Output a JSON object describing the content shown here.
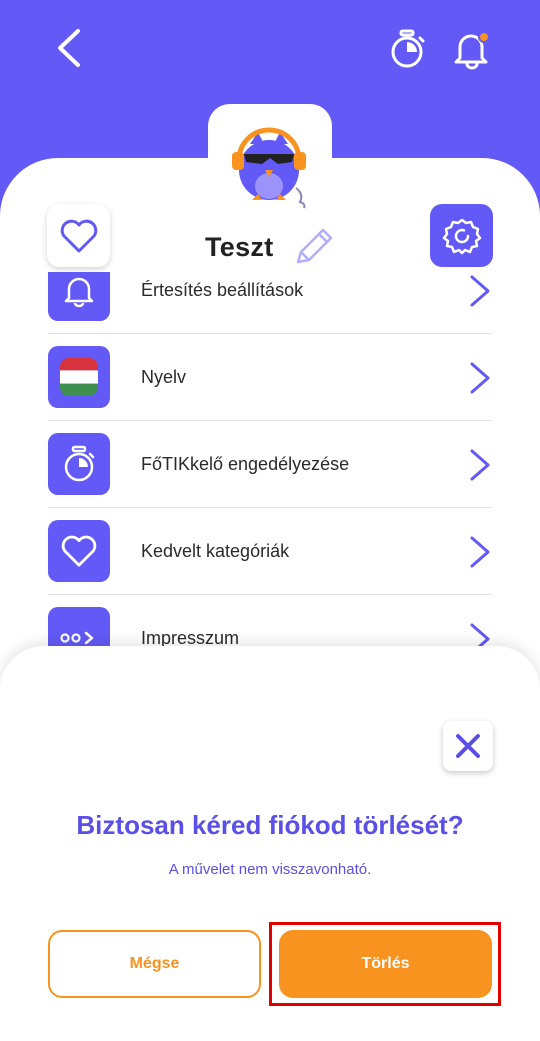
{
  "colors": {
    "brand": "#6359f6",
    "accent_orange": "#f7931e",
    "notification_dot": "#f7931e",
    "highlight_frame": "#e00000"
  },
  "header": {
    "back_icon": "chevron-left-icon",
    "timer_icon": "stopwatch-icon",
    "bell_icon": "bell-icon"
  },
  "profile": {
    "name": "Teszt",
    "avatar": "owl-with-sunglasses-and-headphones",
    "favorite_icon": "heart-icon",
    "settings_icon": "gear-icon",
    "edit_icon": "pencil-icon"
  },
  "menu": {
    "items": [
      {
        "label": "Értesítés beállítások",
        "icon": "bell-icon"
      },
      {
        "label": "Nyelv",
        "icon": "hungarian-flag-icon"
      },
      {
        "label": "FőTIKkelő engedélyezése",
        "icon": "stopwatch-icon"
      },
      {
        "label": "Kedvelt kategóriák",
        "icon": "heart-icon"
      },
      {
        "label": "Impresszum",
        "icon": "dots-arrow-icon"
      }
    ]
  },
  "dialog": {
    "title": "Biztosan kéred fiókod törlését?",
    "subtitle": "A művelet nem visszavonható.",
    "cancel_label": "Mégse",
    "delete_label": "Törlés",
    "close_icon": "close-icon"
  }
}
